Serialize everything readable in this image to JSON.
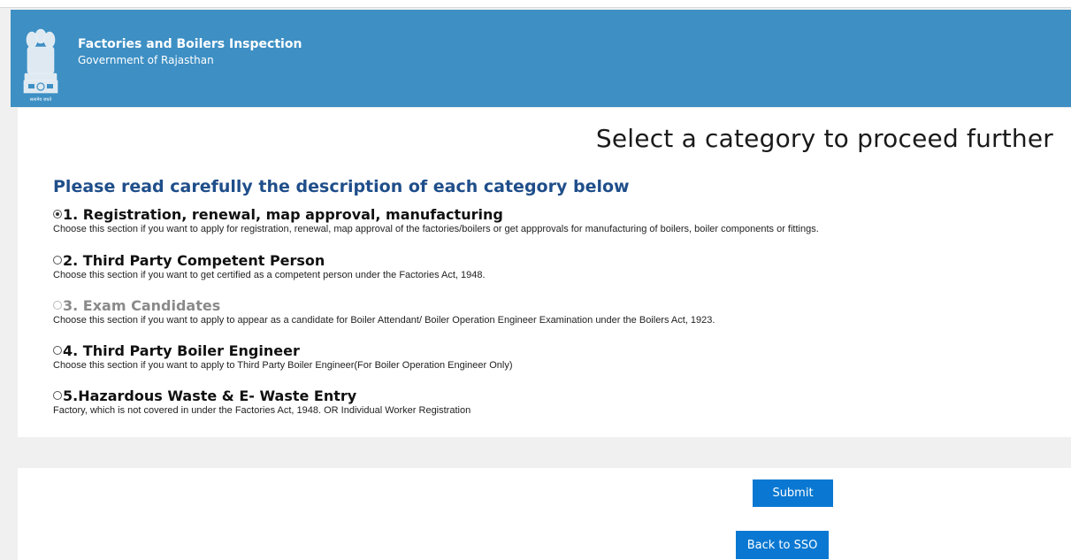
{
  "header": {
    "title": "Factories and Boilers Inspection",
    "subtitle": "Government of Rajasthan",
    "emblem_caption": "सत्यमेव जयते"
  },
  "main": {
    "heading": "Select a category to proceed further",
    "subheading": "Please read carefully the description of each category below",
    "options": [
      {
        "label": "1. Registration, renewal, map approval, manufacturing",
        "description": "Choose this section if you want to apply for registration, renewal, map approval of the factories/boilers or get appprovals for manufacturing of boilers, boiler components or fittings.",
        "checked": true,
        "disabled": false
      },
      {
        "label": "2. Third Party Competent Person",
        "description": "Choose this section if you want to get certified as a competent person under the Factories Act, 1948.",
        "checked": false,
        "disabled": false
      },
      {
        "label": "3. Exam Candidates",
        "description": "Choose this section if you want to apply to appear as a candidate for Boiler Attendant/ Boiler Operation Engineer Examination under the Boilers Act, 1923.",
        "checked": false,
        "disabled": true
      },
      {
        "label": "4. Third Party Boiler Engineer",
        "description": "Choose this section if you want to apply to Third Party Boiler Engineer(For Boiler Operation Engineer Only)",
        "checked": false,
        "disabled": false
      },
      {
        "label": "5.Hazardous Waste & E- Waste Entry",
        "description": "Factory, which is not covered in under the Factories Act, 1948. OR Individual Worker Registration",
        "checked": false,
        "disabled": false
      }
    ]
  },
  "actions": {
    "submit_label": "Submit",
    "back_label": "Back to SSO"
  },
  "colors": {
    "header_bg": "#3d8fc4",
    "heading_blue": "#1f4e8a",
    "button_bg": "#0a78d2"
  },
  "icons": {
    "emblem": "ashoka-emblem-icon"
  }
}
